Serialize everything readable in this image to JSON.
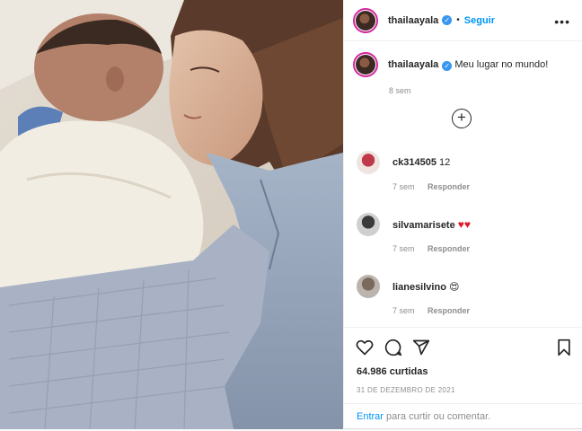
{
  "post": {
    "author": "thailaayala",
    "follow_label": "Seguir",
    "more_icon": "more-options-icon",
    "caption": {
      "username": "thailaayala",
      "text": "Meu lugar no mundo!",
      "time": "8 sem"
    },
    "load_more_icon": "plus-circle-icon"
  },
  "comments": [
    {
      "username": "ck314505",
      "text": "12",
      "time": "7 sem",
      "reply_label": "Responder"
    },
    {
      "username": "silvamarisete",
      "text": "♥♥",
      "time": "7 sem",
      "reply_label": "Responder"
    },
    {
      "username": "lianesilvino",
      "text": "😍",
      "time": "7 sem",
      "reply_label": "Responder"
    }
  ],
  "actions": {
    "icons": [
      "heart-icon",
      "comment-icon",
      "share-icon",
      "bookmark-icon"
    ],
    "likes": "64.986 curtidas",
    "date": "31 DE DEZEMBRO DE 2021",
    "login_link": "Entrar",
    "login_suffix": " para curtir ou comentar."
  },
  "colors": {
    "link_blue": "#0095f6",
    "verified_blue": "#3897f0",
    "muted_gray": "#8e8e8e",
    "heart_red": "#e0152b"
  }
}
